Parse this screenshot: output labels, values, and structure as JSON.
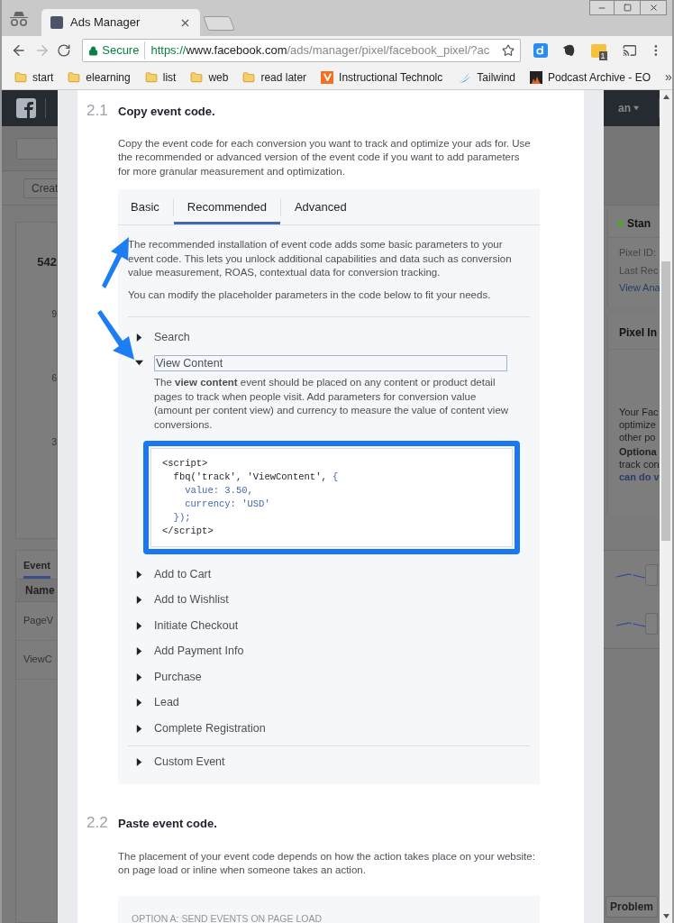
{
  "browser": {
    "tab_title": "Ads Manager",
    "security": "Secure",
    "url_scheme": "https://",
    "url_host": "www.facebook.com",
    "url_path": "/ads/manager/pixel/facebook_pixel/?ac",
    "extension_badge": "1",
    "bookmarks": [
      {
        "label": "start",
        "kind": "folder"
      },
      {
        "label": "elearning",
        "kind": "folder"
      },
      {
        "label": "list",
        "kind": "folder"
      },
      {
        "label": "web",
        "kind": "folder"
      },
      {
        "label": "read later",
        "kind": "folder"
      },
      {
        "label": "Instructional Technolc",
        "kind": "v-site"
      },
      {
        "label": "Tailwind",
        "kind": "wing-site"
      },
      {
        "label": "Podcast Archive - EO",
        "kind": "eof-site"
      }
    ],
    "bookmarks_more": "»"
  },
  "background_left": {
    "create_button": "Creat",
    "stat": "542",
    "axis_labels": [
      "9",
      "6",
      "3"
    ],
    "events_tab": "Event",
    "name_header": "Name",
    "rows": [
      "PageV",
      "ViewC"
    ]
  },
  "background_right": {
    "account": "an",
    "pixel_name": "Stan",
    "pixel_id_label": "Pixel ID:",
    "last_received": "Last Rec",
    "view_link": "View Ana",
    "info_title": "Pixel In",
    "info_lines": [
      "Your Fac",
      "optimize",
      "other po"
    ],
    "optional": "Optiona",
    "optional_lines": [
      "track con"
    ],
    "link": "can do v",
    "problem_button": "Problem"
  },
  "section_1": {
    "number": "2.1",
    "title": "Copy event code.",
    "intro": "Copy the event code for each conversion you want to track and optimize your ads for. Use the recommended or advanced version of the event code if you want to add parameters for more granular measurement and optimization.",
    "tabs": [
      {
        "label": "Basic",
        "selected": false
      },
      {
        "label": "Recommended",
        "selected": true
      },
      {
        "label": "Advanced",
        "selected": false
      }
    ],
    "tab_text": [
      "The recommended installation of event code adds some basic parameters to your event code. This lets you unlock additional capabilities and data such as conversion value measurement, ROAS, contextual data for conversion tracking.",
      "You can modify the placeholder parameters in the code below to fit your needs."
    ],
    "events": [
      {
        "label": "Search",
        "expanded": false
      },
      {
        "label": "View Content",
        "expanded": true,
        "description": "The **view content** event should be placed on any content or product detail pages to track when people visit. Add parameters for conversion value (amount per content view) and currency to measure the value of content view conversions.",
        "code": [
          [
            {
              "text": "<script>",
              "kind": "plain"
            }
          ],
          [
            {
              "text": "  fbq('track', 'ViewContent', ",
              "kind": "plain"
            },
            {
              "text": "{",
              "kind": "param"
            }
          ],
          [
            {
              "text": "    value: 3.50,",
              "kind": "param"
            }
          ],
          [
            {
              "text": "    currency: 'USD'",
              "kind": "param"
            }
          ],
          [
            {
              "text": "  });",
              "kind": "param"
            }
          ],
          [
            {
              "text": "</script>",
              "kind": "plain"
            }
          ]
        ]
      },
      {
        "label": "Add to Cart",
        "expanded": false
      },
      {
        "label": "Add to Wishlist",
        "expanded": false
      },
      {
        "label": "Initiate Checkout",
        "expanded": false
      },
      {
        "label": "Add Payment Info",
        "expanded": false
      },
      {
        "label": "Purchase",
        "expanded": false
      },
      {
        "label": "Lead",
        "expanded": false
      },
      {
        "label": "Complete Registration",
        "expanded": false
      }
    ],
    "custom_events": [
      {
        "label": "Custom Event",
        "expanded": false
      }
    ]
  },
  "section_2": {
    "number": "2.2",
    "title": "Paste event code.",
    "intro": "The placement of your event code depends on how the action takes place on your website: on page load or inline when someone takes an action.",
    "option_heading": "OPTION A: SEND EVENTS ON PAGE LOAD"
  }
}
